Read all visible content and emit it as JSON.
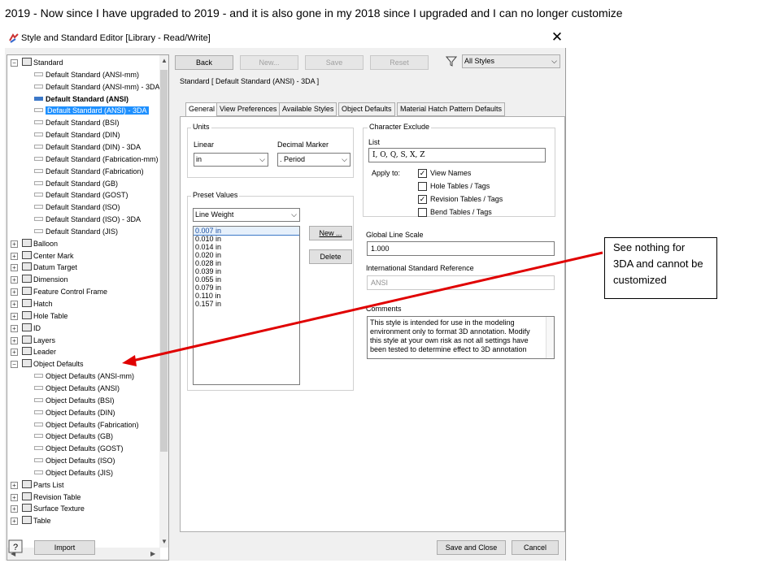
{
  "caption": "2019 - Now since I have upgraded to 2019 - and it is also gone in my 2018 since I upgraded and I can no longer customize",
  "window": {
    "title": "Style and Standard Editor [Library - Read/Write]",
    "close_glyph": "✕"
  },
  "tree": {
    "root_label": "Standard",
    "standard_children": [
      "Default Standard (ANSI-mm)",
      "Default Standard (ANSI-mm) - 3DA",
      "Default Standard (ANSI)",
      "Default Standard (ANSI) - 3DA",
      "Default Standard (BSI)",
      "Default Standard (DIN)",
      "Default Standard (DIN) - 3DA",
      "Default Standard (Fabrication-mm)",
      "Default Standard (Fabrication)",
      "Default Standard (GB)",
      "Default Standard (GOST)",
      "Default Standard (ISO)",
      "Default Standard (ISO) - 3DA",
      "Default Standard (JIS)"
    ],
    "categories": [
      {
        "label": "Balloon",
        "icon": "balloon-icon"
      },
      {
        "label": "Center Mark",
        "icon": "center-mark-icon"
      },
      {
        "label": "Datum Target",
        "icon": "datum-target-icon"
      },
      {
        "label": "Dimension",
        "icon": "dimension-icon"
      },
      {
        "label": "Feature Control Frame",
        "icon": "feature-control-frame-icon"
      },
      {
        "label": "Hatch",
        "icon": "hatch-icon"
      },
      {
        "label": "Hole Table",
        "icon": "hole-table-icon"
      },
      {
        "label": "ID",
        "icon": "id-icon"
      },
      {
        "label": "Layers",
        "icon": "layers-icon"
      },
      {
        "label": "Leader",
        "icon": "leader-icon"
      },
      {
        "label": "Object Defaults",
        "icon": "object-defaults-icon"
      }
    ],
    "object_defaults_children": [
      "Object Defaults (ANSI-mm)",
      "Object Defaults (ANSI)",
      "Object Defaults (BSI)",
      "Object Defaults (DIN)",
      "Object Defaults (Fabrication)",
      "Object Defaults (GB)",
      "Object Defaults (GOST)",
      "Object Defaults (ISO)",
      "Object Defaults (JIS)"
    ],
    "bottom_categories": [
      {
        "label": "Parts List",
        "icon": "parts-list-icon"
      },
      {
        "label": "Revision Table",
        "icon": "revision-table-icon"
      },
      {
        "label": "Surface Texture",
        "icon": "surface-texture-icon"
      },
      {
        "label": "Table",
        "icon": "table-icon"
      }
    ]
  },
  "toolbar": {
    "back": "Back",
    "new": "New...",
    "save": "Save",
    "reset": "Reset",
    "filter": "All Styles"
  },
  "header": "Standard [ Default Standard (ANSI) - 3DA ]",
  "tabs": [
    "General",
    "View Preferences",
    "Available Styles",
    "Object Defaults",
    "Material Hatch Pattern Defaults"
  ],
  "units": {
    "group": "Units",
    "linear_label": "Linear",
    "linear_value": "in",
    "decimal_label": "Decimal Marker",
    "decimal_value": ". Period"
  },
  "character_exclude": {
    "group": "Character Exclude",
    "list_label": "List",
    "list_value": "I, O, Q, S, X, Z",
    "apply_to": "Apply to:",
    "options": [
      {
        "label": "View Names",
        "checked": true
      },
      {
        "label": "Hole Tables / Tags",
        "checked": false
      },
      {
        "label": "Revision Tables / Tags",
        "checked": true
      },
      {
        "label": "Bend Tables / Tags",
        "checked": false
      }
    ]
  },
  "preset": {
    "group": "Preset Values",
    "type": "Line Weight",
    "values": [
      "0.007 in",
      "0.010 in",
      "0.014 in",
      "0.020 in",
      "0.028 in",
      "0.039 in",
      "0.055 in",
      "0.079 in",
      "0.110 in",
      "0.157 in"
    ],
    "new_btn": "New ...",
    "delete_btn": "Delete"
  },
  "global_line_scale": {
    "label": "Global Line Scale",
    "value": "1.000"
  },
  "isr": {
    "label": "International Standard Reference",
    "value": "ANSI"
  },
  "comments": {
    "label": "Comments",
    "text": "This style is intended for use in the modeling environment only to format 3D annotation.  Modify this style at your own risk as not all  settings have been tested to determine effect to 3D annotation"
  },
  "footer": {
    "import": "Import",
    "save_close": "Save and Close",
    "cancel": "Cancel"
  },
  "callout": "See nothing for 3DA and cannot be customized",
  "colors": {
    "selection": "#1e90ff",
    "arrow": "#e00000"
  }
}
